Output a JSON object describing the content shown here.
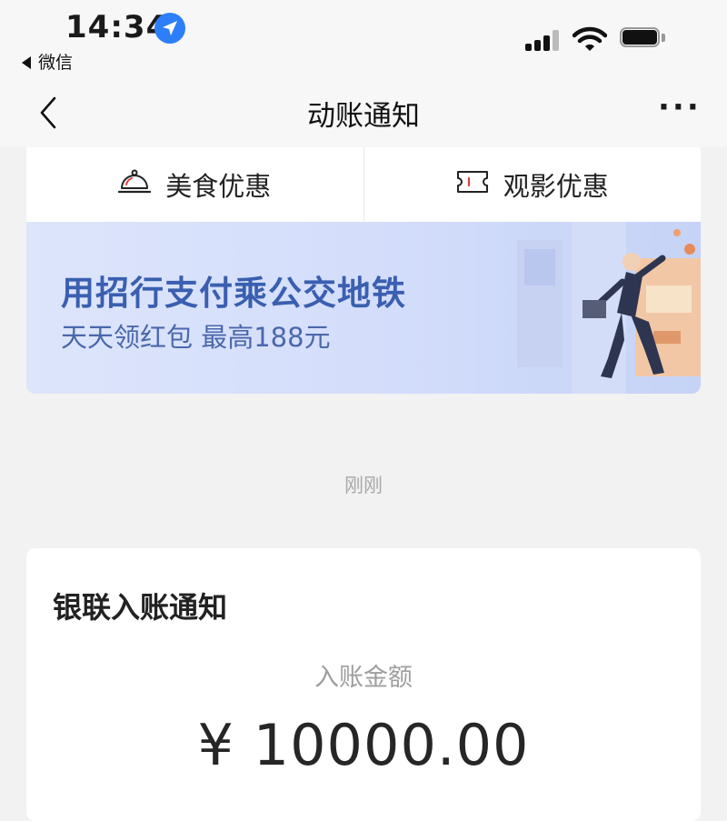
{
  "status_bar": {
    "time": "14:34",
    "back_app": "微信",
    "icons": [
      "location-icon",
      "signal-icon",
      "wifi-icon",
      "battery-icon"
    ]
  },
  "nav": {
    "title": "动账通知",
    "more": "···",
    "back_icon": "chevron-left-icon"
  },
  "tabs": [
    {
      "label": "美食优惠",
      "icon": "dish-bell-icon"
    },
    {
      "label": "观影优惠",
      "icon": "ticket-icon"
    }
  ],
  "banner": {
    "title": "用招行支付乘公交地铁",
    "subtitle": "天天领红包 最高188元",
    "accent": "#3a5fb0"
  },
  "timestamp": "刚刚",
  "card": {
    "title": "银联入账通知",
    "amount_label": "入账金额",
    "amount": "¥ 10000.00"
  }
}
